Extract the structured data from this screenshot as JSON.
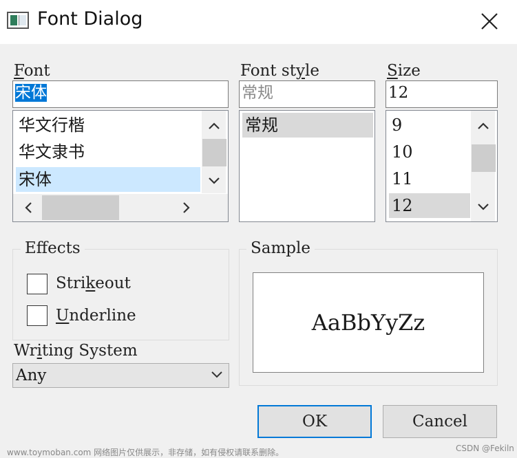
{
  "window": {
    "title": "Font Dialog",
    "close_icon": "close-icon"
  },
  "font": {
    "label_underlined": "F",
    "label_rest": "ont",
    "value": "宋体",
    "items": [
      "华文行楷",
      "华文隶书",
      "宋体"
    ],
    "selected": "宋体"
  },
  "style": {
    "label_pre": "Font st",
    "label_underlined": "y",
    "label_post": "le",
    "value": "常规",
    "items": [
      "常规"
    ],
    "selected": "常规"
  },
  "size": {
    "label_underlined": "S",
    "label_rest": "ize",
    "value": "12",
    "items": [
      "9",
      "10",
      "11",
      "12"
    ],
    "selected": "12"
  },
  "effects": {
    "title": "Effects",
    "strikeout_pre": "Stri",
    "strikeout_underlined": "k",
    "strikeout_post": "eout",
    "strikeout_checked": false,
    "underline_underlined": "U",
    "underline_rest": "nderline",
    "underline_checked": false
  },
  "writing_system": {
    "label_pre": "Wr",
    "label_underlined": "i",
    "label_post": "ting System",
    "value": "Any"
  },
  "sample": {
    "title": "Sample",
    "text": "AaBbYyZz"
  },
  "buttons": {
    "ok": "OK",
    "cancel": "Cancel"
  },
  "watermark": {
    "left": "www.toymoban.com 网络图片仅供展示，非存储，如有侵权请联系删除。",
    "right": "CSDN @Fekiln"
  },
  "colors": {
    "accent": "#0078d7",
    "selection": "#cce8ff"
  }
}
